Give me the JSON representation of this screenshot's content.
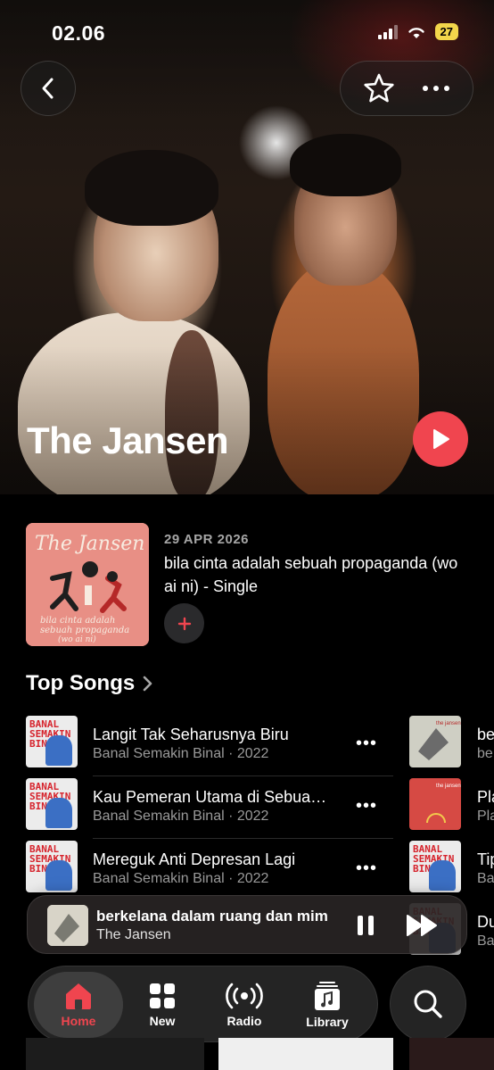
{
  "status_bar": {
    "time": "02.06",
    "battery": "27"
  },
  "artist": {
    "name": "The Jansen"
  },
  "latest_release": {
    "date": "29 APR 2026",
    "title": "bila cinta adalah sebuah propaganda (wo ai ni) - Single",
    "art_text": "The Jansen",
    "art_caption": "bila cinta adalah sebuah propaganda (wo ai ni)"
  },
  "top_songs": {
    "heading": "Top Songs",
    "column1": [
      {
        "title": "Langit Tak Seharusnya Biru",
        "subtitle": "Banal Semakin Binal · 2022"
      },
      {
        "title": "Kau Pemeran Utama di Sebua…",
        "subtitle": "Banal Semakin Binal · 2022"
      },
      {
        "title": "Mereguk Anti Depresan Lagi",
        "subtitle": "Banal Semakin Binal · 2022"
      }
    ],
    "column2": [
      {
        "title": "be",
        "subtitle": "be"
      },
      {
        "title": "Pla",
        "subtitle": "Pla"
      },
      {
        "title": "Tip",
        "subtitle": "Ba"
      },
      {
        "title": "Du",
        "subtitle": "Ba"
      }
    ],
    "thumb_text": "BANAL SEMAKIN BINAL"
  },
  "mini_player": {
    "title": "berkelana dalam ruang dan mim",
    "artist": "The Jansen"
  },
  "tabs": [
    {
      "label": "Home",
      "icon": "home-icon",
      "active": true
    },
    {
      "label": "New",
      "icon": "grid-icon",
      "active": false
    },
    {
      "label": "Radio",
      "icon": "radio-icon",
      "active": false
    },
    {
      "label": "Library",
      "icon": "library-icon",
      "active": false
    }
  ],
  "colors": {
    "accent": "#f0454f",
    "background": "#000000",
    "secondary_text": "#9a9a9a"
  }
}
